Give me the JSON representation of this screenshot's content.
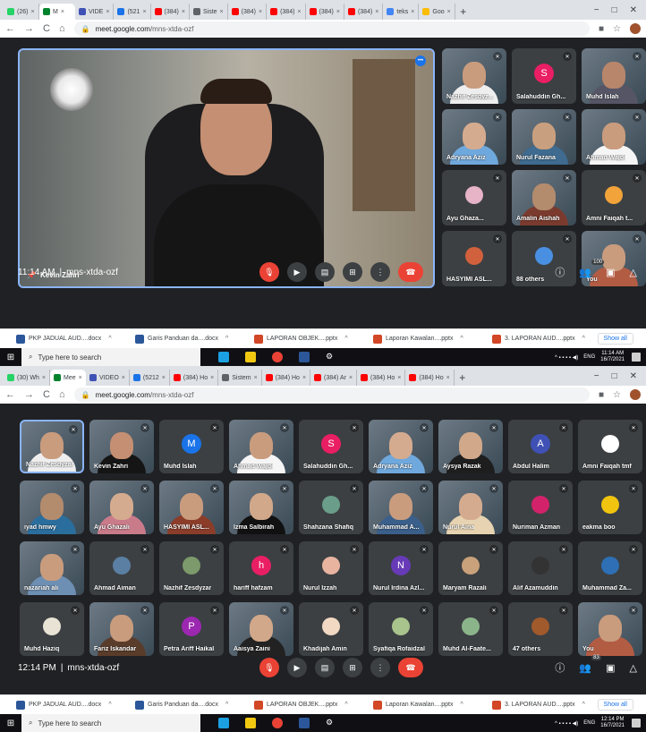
{
  "colors": {
    "meet_bg": "#202124",
    "accent": "#8ab4f8",
    "hangup": "#ea4335",
    "tile": "#3c4043"
  },
  "shot1": {
    "tabs": [
      {
        "label": "(26)",
        "color": "#25d366",
        "active": false
      },
      {
        "label": "M",
        "color": "#00832d",
        "active": true
      },
      {
        "label": "VIDE",
        "color": "#3f51b5",
        "active": false
      },
      {
        "label": "(521",
        "color": "#1a73e8",
        "active": false
      },
      {
        "label": "(384)",
        "color": "#ff0000",
        "active": false
      },
      {
        "label": "Siste",
        "color": "#5f6368",
        "active": false
      },
      {
        "label": "(384)",
        "color": "#ff0000",
        "active": false
      },
      {
        "label": "(384)",
        "color": "#ff0000",
        "active": false
      },
      {
        "label": "(384)",
        "color": "#ff0000",
        "active": false
      },
      {
        "label": "(384)",
        "color": "#ff0000",
        "active": false
      },
      {
        "label": "teks",
        "color": "#4285f4",
        "active": false
      },
      {
        "label": "Goo",
        "color": "#fbbc04",
        "active": false
      }
    ],
    "url_host": "meet.google.com",
    "url_path": "/mns-xtda-ozf",
    "main_speaker": "Kevin Zahri",
    "side_tiles": [
      {
        "name": "Nazhif Zesdyz...",
        "kind": "video",
        "skin": "#c99c7e",
        "shirt": "#eee"
      },
      {
        "name": "Salahuddin Gh...",
        "kind": "initial",
        "letter": "S",
        "color": "#e91e63"
      },
      {
        "name": "Muhd Islah",
        "kind": "video",
        "skin": "#b8866b",
        "shirt": "#556"
      },
      {
        "name": "Adryana Aziz",
        "kind": "video",
        "skin": "#d5ab8f",
        "shirt": "#6fa8dc"
      },
      {
        "name": "Nurul Fazana",
        "kind": "video",
        "skin": "#c9a07f",
        "shirt": "#3e6b8f"
      },
      {
        "name": "Ahmad Wajdi",
        "kind": "video",
        "skin": "#c99c7e",
        "shirt": "#f5f5f5"
      },
      {
        "name": "Ayu Ghaza...",
        "kind": "photo",
        "color": "#e6b3c7"
      },
      {
        "name": "Amalin Aishah",
        "kind": "video",
        "skin": "#b38b6d",
        "shirt": "#7a3b2e"
      },
      {
        "name": "Amni Faiqah t...",
        "kind": "photo",
        "color": "#f2a33a"
      },
      {
        "name": "HASYIMI ASL...",
        "kind": "photo",
        "color": "#d1603d"
      },
      {
        "name": "88 others",
        "kind": "others",
        "color": "#4a90e2"
      },
      {
        "name": "You",
        "kind": "video",
        "skin": "#c99c7e",
        "shirt": "#b35c44"
      }
    ],
    "time": "11:14 AM",
    "meeting_code": "mns-xtda-ozf",
    "participants_count": "100",
    "downloads": [
      "PKP JADUAL AUD....docx",
      "Garis Panduan da....docx",
      "LAPORAN OBJEK....pptx",
      "Laporan Kawalan....pptx",
      "3. LAPORAN AUD....pptx"
    ],
    "show_all": "Show all",
    "search_placeholder": "Type here to search",
    "tray_lang": "ENG",
    "clock_time": "11:14 AM",
    "clock_date": "16/7/2021"
  },
  "shot2": {
    "tabs": [
      {
        "label": "(30) Wh",
        "color": "#25d366",
        "active": false
      },
      {
        "label": "Mee",
        "color": "#00832d",
        "active": true
      },
      {
        "label": "VIDEO",
        "color": "#3f51b5",
        "active": false
      },
      {
        "label": "(5212",
        "color": "#1a73e8",
        "active": false
      },
      {
        "label": "(384) Ho",
        "color": "#ff0000",
        "active": false
      },
      {
        "label": "Sistem",
        "color": "#5f6368",
        "active": false
      },
      {
        "label": "(384) Ho",
        "color": "#ff0000",
        "active": false
      },
      {
        "label": "(384) Ar",
        "color": "#ff0000",
        "active": false
      },
      {
        "label": "(384) Ho",
        "color": "#ff0000",
        "active": false
      },
      {
        "label": "(384) Ho",
        "color": "#ff0000",
        "active": false
      }
    ],
    "url_host": "meet.google.com",
    "url_path": "/mns-xtda-ozf",
    "grid": [
      {
        "name": "Nazhif Zesdyzar",
        "kind": "video",
        "skin": "#c99c7e",
        "shirt": "#eee",
        "pinned": true
      },
      {
        "name": "Kevin Zahri",
        "kind": "video",
        "skin": "#c48f72",
        "shirt": "#151515"
      },
      {
        "name": "Muhd Islah",
        "kind": "initial",
        "letter": "M",
        "color": "#1a73e8"
      },
      {
        "name": "Ahmad Wajdi",
        "kind": "video",
        "skin": "#c99c7e",
        "shirt": "#f5f5f5"
      },
      {
        "name": "Salahuddin Gh...",
        "kind": "initial",
        "letter": "S",
        "color": "#e91e63"
      },
      {
        "name": "Adryana Aziz",
        "kind": "video",
        "skin": "#d5ab8f",
        "shirt": "#6fa8dc"
      },
      {
        "name": "Aysya Razak",
        "kind": "video",
        "skin": "#d1a88a",
        "shirt": "#1e1e1e"
      },
      {
        "name": "Abdul Halim",
        "kind": "initial",
        "letter": "A",
        "color": "#3f51b5"
      },
      {
        "name": "Amni Faiqah tmf",
        "kind": "photo",
        "color": "#ffffff"
      },
      {
        "name": "iyad hmwy",
        "kind": "video",
        "skin": "#b38b6d",
        "shirt": "#2a6e9e"
      },
      {
        "name": "Ayu Ghazali",
        "kind": "video",
        "skin": "#d5ab8f",
        "shirt": "#c97b8a"
      },
      {
        "name": "HASYIMI ASL...",
        "kind": "video",
        "skin": "#c99c7e",
        "shirt": "#8b3d2a"
      },
      {
        "name": "Izma Salbirah",
        "kind": "video",
        "skin": "#d1a88a",
        "shirt": "#111"
      },
      {
        "name": "Shahzana Shafiq",
        "kind": "photo",
        "color": "#6b9e8a"
      },
      {
        "name": "Muhammad A...",
        "kind": "video",
        "skin": "#c99c7e",
        "shirt": "#3a5f8a"
      },
      {
        "name": "Nurul Aina",
        "kind": "video",
        "skin": "#d5ab8f",
        "shirt": "#e7d3b1"
      },
      {
        "name": "Nuriman Azman",
        "kind": "photo",
        "color": "#d2226a"
      },
      {
        "name": "eakma boo",
        "kind": "photo",
        "color": "#f1c40f"
      },
      {
        "name": "nazariah ali",
        "kind": "video",
        "skin": "#c99c7e",
        "shirt": "#6d8fb3"
      },
      {
        "name": "Ahmad Aiman",
        "kind": "photo",
        "color": "#5b7fa3"
      },
      {
        "name": "Nazhif Zesdyzar",
        "kind": "photo",
        "color": "#7c9a6b"
      },
      {
        "name": "hariff hafzam",
        "kind": "initial",
        "letter": "h",
        "color": "#e91e63"
      },
      {
        "name": "Nurul Izzah",
        "kind": "photo",
        "color": "#e8b4a0"
      },
      {
        "name": "Nurul Irdina Azl...",
        "kind": "initial",
        "letter": "N",
        "color": "#673ab7"
      },
      {
        "name": "Maryam Razali",
        "kind": "photo",
        "color": "#c9a17a"
      },
      {
        "name": "Alif Azamuddin",
        "kind": "photo",
        "color": "#333"
      },
      {
        "name": "Muhammad Za...",
        "kind": "photo",
        "color": "#2e6fb5"
      },
      {
        "name": "Muhd Haziq",
        "kind": "photo",
        "color": "#e9e3d5"
      },
      {
        "name": "Fariz Iskandar",
        "kind": "video",
        "skin": "#c99c7e",
        "shirt": "#5a3c2a"
      },
      {
        "name": "Petra Ariff Haikal",
        "kind": "initial",
        "letter": "P",
        "color": "#9c27b0"
      },
      {
        "name": "Aaisya Zaini",
        "kind": "video",
        "skin": "#d1a88a",
        "shirt": "#222"
      },
      {
        "name": "Khadijah Amin",
        "kind": "photo",
        "color": "#f2d9c4"
      },
      {
        "name": "Syafiqa Rofaidzal",
        "kind": "photo",
        "color": "#a9c48c"
      },
      {
        "name": "Muhd Al-Faate...",
        "kind": "photo",
        "color": "#8bb48a"
      },
      {
        "name": "47 others",
        "kind": "others",
        "color": "#a05a2c"
      },
      {
        "name": "You",
        "kind": "video",
        "skin": "#c99c7e",
        "shirt": "#b35c44"
      }
    ],
    "time": "12:14 PM",
    "meeting_code": "mns-xtda-ozf",
    "participants_count": "83",
    "downloads": [
      "PKP JADUAL AUD....docx",
      "Garis Panduan da....docx",
      "LAPORAN OBJEK....pptx",
      "Laporan Kawalan....pptx",
      "3. LAPORAN AUD....pptx"
    ],
    "show_all": "Show all",
    "search_placeholder": "Type here to search",
    "tray_lang": "ENG",
    "clock_time": "12:14 PM",
    "clock_date": "16/7/2021"
  }
}
